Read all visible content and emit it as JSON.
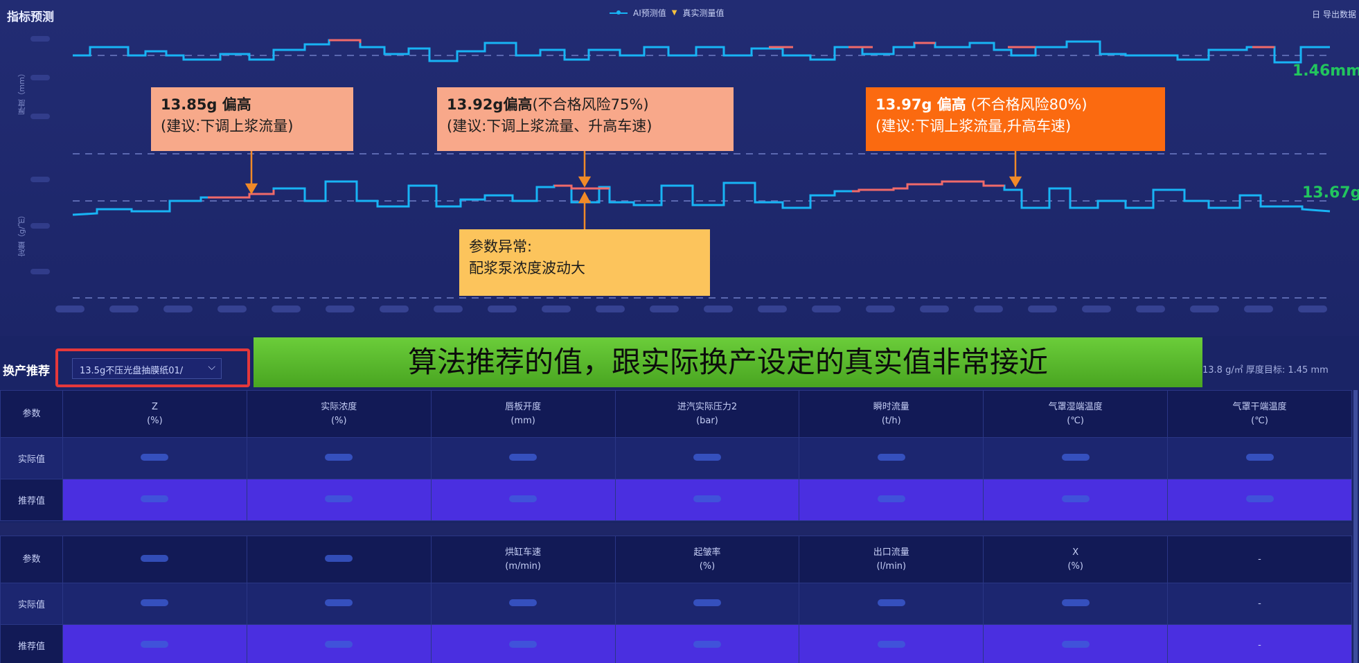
{
  "top_panel": {
    "title": "指标预测",
    "legend": {
      "ai_label": "AI预测值",
      "real_label": "真实测量值"
    },
    "export_label": "日 导出数据",
    "thickness_axis_label": "厚度（mm）",
    "weight_axis_label": "定量（g/㎡）",
    "thickness_end_value": "1.46mm",
    "weight_end_value": "13.67g"
  },
  "annotations": {
    "a1": {
      "bold": "13.85g 偏高",
      "rest": "",
      "line2": "(建议:下调上浆流量)"
    },
    "a2": {
      "bold": "13.92g偏高",
      "rest": "(不合格风险75%)",
      "line2": "(建议:下调上浆流量、升高车速)"
    },
    "a3": {
      "bold": "13.97g 偏高",
      "rest": " (不合格风险80%)",
      "line2": "(建议:下调上浆流量,升高车速)"
    },
    "a4": {
      "line1": "参数异常:",
      "line2": "配浆泵浓度波动大"
    }
  },
  "banner_text": "算法推荐的值，跟实际换产设定的真实值非常接近",
  "lower": {
    "section_title": "换产推荐",
    "select_value": "13.5g不压光盘抽膜纸01/",
    "targets_text": "13.8 g/㎡    厚度目标: 1.45 mm"
  },
  "table1": {
    "row_labels": [
      "参数",
      "实际值",
      "推荐值"
    ],
    "headers": [
      [
        "Z",
        "(%)"
      ],
      [
        "实际浓度",
        "(%)"
      ],
      [
        "唇板开度",
        "(mm)"
      ],
      [
        "进汽实际压力2",
        "(bar)"
      ],
      [
        "瞬时流量",
        "(t/h)"
      ],
      [
        "气罩湿端温度",
        "(℃)"
      ],
      [
        "气罩干端温度",
        "(℃)"
      ]
    ]
  },
  "table2": {
    "row_labels": [
      "参数",
      "实际值",
      "推荐值"
    ],
    "headers": [
      [
        "",
        ""
      ],
      [
        "",
        ""
      ],
      [
        "烘缸车速",
        "(m/min)"
      ],
      [
        "起皱率",
        "(%)"
      ],
      [
        "出口流量",
        "(l/min)"
      ],
      [
        "X",
        "(%)"
      ],
      [
        "-",
        ""
      ]
    ],
    "empty_marker": "-"
  },
  "colors": {
    "line_ai": "#18b4f5",
    "line_alert": "#f06a6a",
    "end_value": "#22c55e",
    "banner": "#5bbd2e",
    "highlight_border": "#e5383b"
  }
}
